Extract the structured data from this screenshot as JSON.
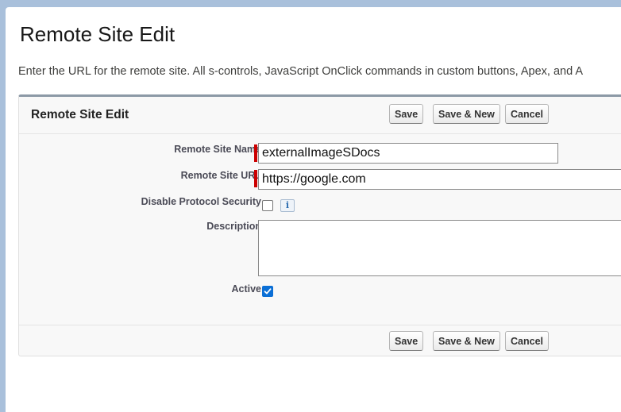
{
  "page": {
    "title": "Remote Site Edit",
    "intro": "Enter the URL for the remote site. All s-controls, JavaScript OnClick commands in custom buttons, Apex, and A"
  },
  "block": {
    "title": "Remote Site Edit",
    "buttons": {
      "save": "Save",
      "save_new": "Save & New",
      "cancel": "Cancel"
    }
  },
  "form": {
    "name": {
      "label": "Remote Site Name",
      "value": "externalImageSDocs",
      "required": true
    },
    "url": {
      "label": "Remote Site URL",
      "value": "https://google.com",
      "required": true
    },
    "disable_protocol_security": {
      "label": "Disable Protocol Security",
      "checked": false,
      "info_icon": "i"
    },
    "description": {
      "label": "Description",
      "value": ""
    },
    "active": {
      "label": "Active",
      "checked": true
    }
  },
  "colors": {
    "required_bar": "#cc0000",
    "checkbox_checked": "#0b6fd6"
  }
}
